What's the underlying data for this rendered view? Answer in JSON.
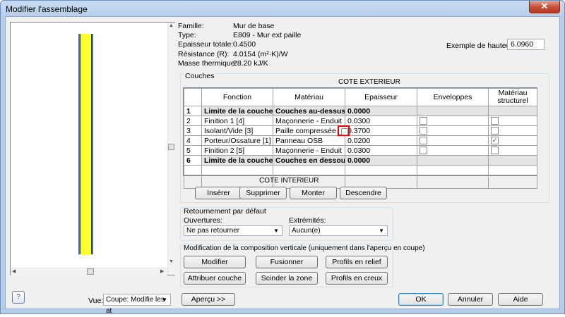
{
  "window": {
    "title": "Modifier l'assemblage",
    "close": "✕"
  },
  "info": {
    "famille_label": "Famille:",
    "famille_value": "Mur de base",
    "type_label": "Type:",
    "type_value": "E809 - Mur ext paille",
    "epaisseur_label": "Epaisseur totale:",
    "epaisseur_value": "0.4500",
    "resistance_label": "Résistance (R):",
    "resistance_value": "4.0154 (m²·K)/W",
    "masse_label": "Masse thermique:",
    "masse_value": "28.20 kJ/K",
    "hauteur_label": "Exemple de hauteur:",
    "hauteur_value": "6.0960"
  },
  "layers": {
    "group_title": "Couches",
    "top_caption": "COTE EXTERIEUR",
    "bottom_caption": "COTE INTERIEUR",
    "headers": [
      "",
      "Fonction",
      "Matériau",
      "Epaisseur",
      "Enveloppes",
      "Matériau structurel"
    ],
    "rows": [
      {
        "num": "1",
        "fonction": "Limite de la couche prin",
        "materiau": "Couches au-dessus",
        "epaisseur": "0.0000",
        "bold": true,
        "env": null,
        "struct": null
      },
      {
        "num": "2",
        "fonction": "Finition 1 [4]",
        "materiau": "Maçonnerie - Enduit",
        "epaisseur": "0.0300",
        "bold": false,
        "env": false,
        "struct": false
      },
      {
        "num": "3",
        "fonction": "Isolant/Vide [3]",
        "materiau": "Paille compressée",
        "epaisseur": "0.3700",
        "bold": false,
        "env": false,
        "struct": false
      },
      {
        "num": "4",
        "fonction": "Porteur/Ossature [1]",
        "materiau": "Panneau OSB",
        "epaisseur": "0.0200",
        "bold": false,
        "env": false,
        "struct": true
      },
      {
        "num": "5",
        "fonction": "Finition 2 [5]",
        "materiau": "Maçonnerie - Enduit",
        "epaisseur": "0.0300",
        "bold": false,
        "env": false,
        "struct": false
      },
      {
        "num": "6",
        "fonction": "Limite de la couche prin",
        "materiau": "Couches en dessous",
        "epaisseur": "0.0000",
        "bold": true,
        "env": null,
        "struct": null
      }
    ],
    "buttons": {
      "inserer": "Insérer",
      "supprimer": "Supprimer",
      "monter": "Monter",
      "descendre": "Descendre"
    }
  },
  "retournement": {
    "title": "Retournement par défaut",
    "ouvertures_label": "Ouvertures:",
    "ouvertures_value": "Ne pas retourner",
    "extremites_label": "Extrémités:",
    "extremites_value": "Aucun(e)"
  },
  "modification": {
    "title": "Modification de la composition verticale (uniquement dans l'aperçu en coupe)",
    "buttons": [
      "Modifier",
      "Fusionner",
      "Profils en relief",
      "Attribuer couche",
      "Scinder la zone",
      "Profils en creux"
    ]
  },
  "footer": {
    "vue_label": "Vue:",
    "vue_value": "Coupe: Modifie les at",
    "apercu": "Aperçu >>",
    "ok": "OK",
    "annuler": "Annuler",
    "aide": "Aide"
  },
  "icons": {
    "material_browse": "material-browse-icon",
    "help_icon": "help-icon"
  }
}
